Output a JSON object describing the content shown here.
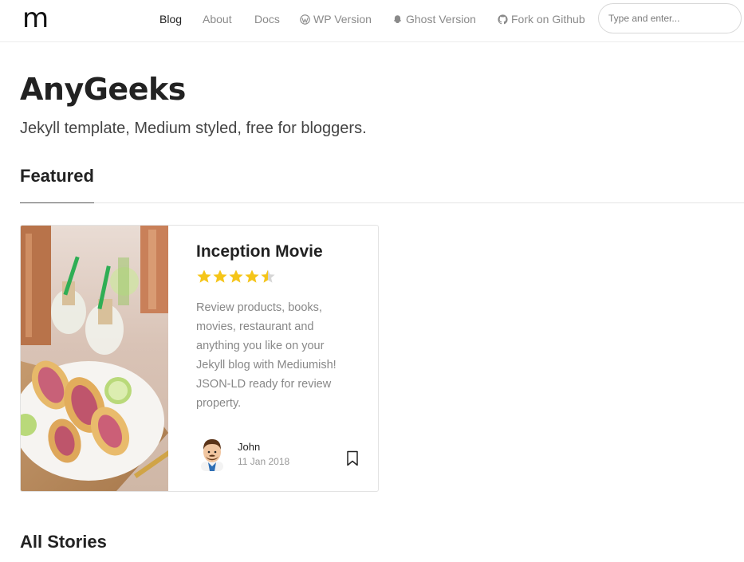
{
  "brand": {
    "logo_text": "m"
  },
  "nav": {
    "items": [
      {
        "label": "Blog",
        "icon": "",
        "active": true
      },
      {
        "label": "About",
        "icon": "",
        "active": false
      },
      {
        "label": "Docs",
        "icon": "",
        "active": false
      },
      {
        "label": "WP Version",
        "icon": "wordpress-icon",
        "active": false
      },
      {
        "label": "Ghost Version",
        "icon": "ghost-icon",
        "active": false
      },
      {
        "label": "Fork on Github",
        "icon": "github-icon",
        "active": false
      }
    ]
  },
  "search": {
    "placeholder": "Type and enter...",
    "value": ""
  },
  "header": {
    "title": "AnyGeeks",
    "tagline": "Jekyll template, Medium styled, free for bloggers."
  },
  "featured": {
    "heading": "Featured",
    "post": {
      "title": "Inception Movie",
      "rating": 4.5,
      "rating_max": 5,
      "excerpt": "Review products, books, movies, restaurant and anything you like on your Jekyll blog with Mediumish! JSON-LD ready for review property.",
      "author": "John",
      "date": "11 Jan 2018"
    }
  },
  "all_stories": {
    "heading": "All Stories"
  },
  "colors": {
    "star": "#f5c518",
    "star_empty": "#d6d6d6",
    "text_muted": "#888888",
    "nav_muted": "#8a8a8a"
  }
}
